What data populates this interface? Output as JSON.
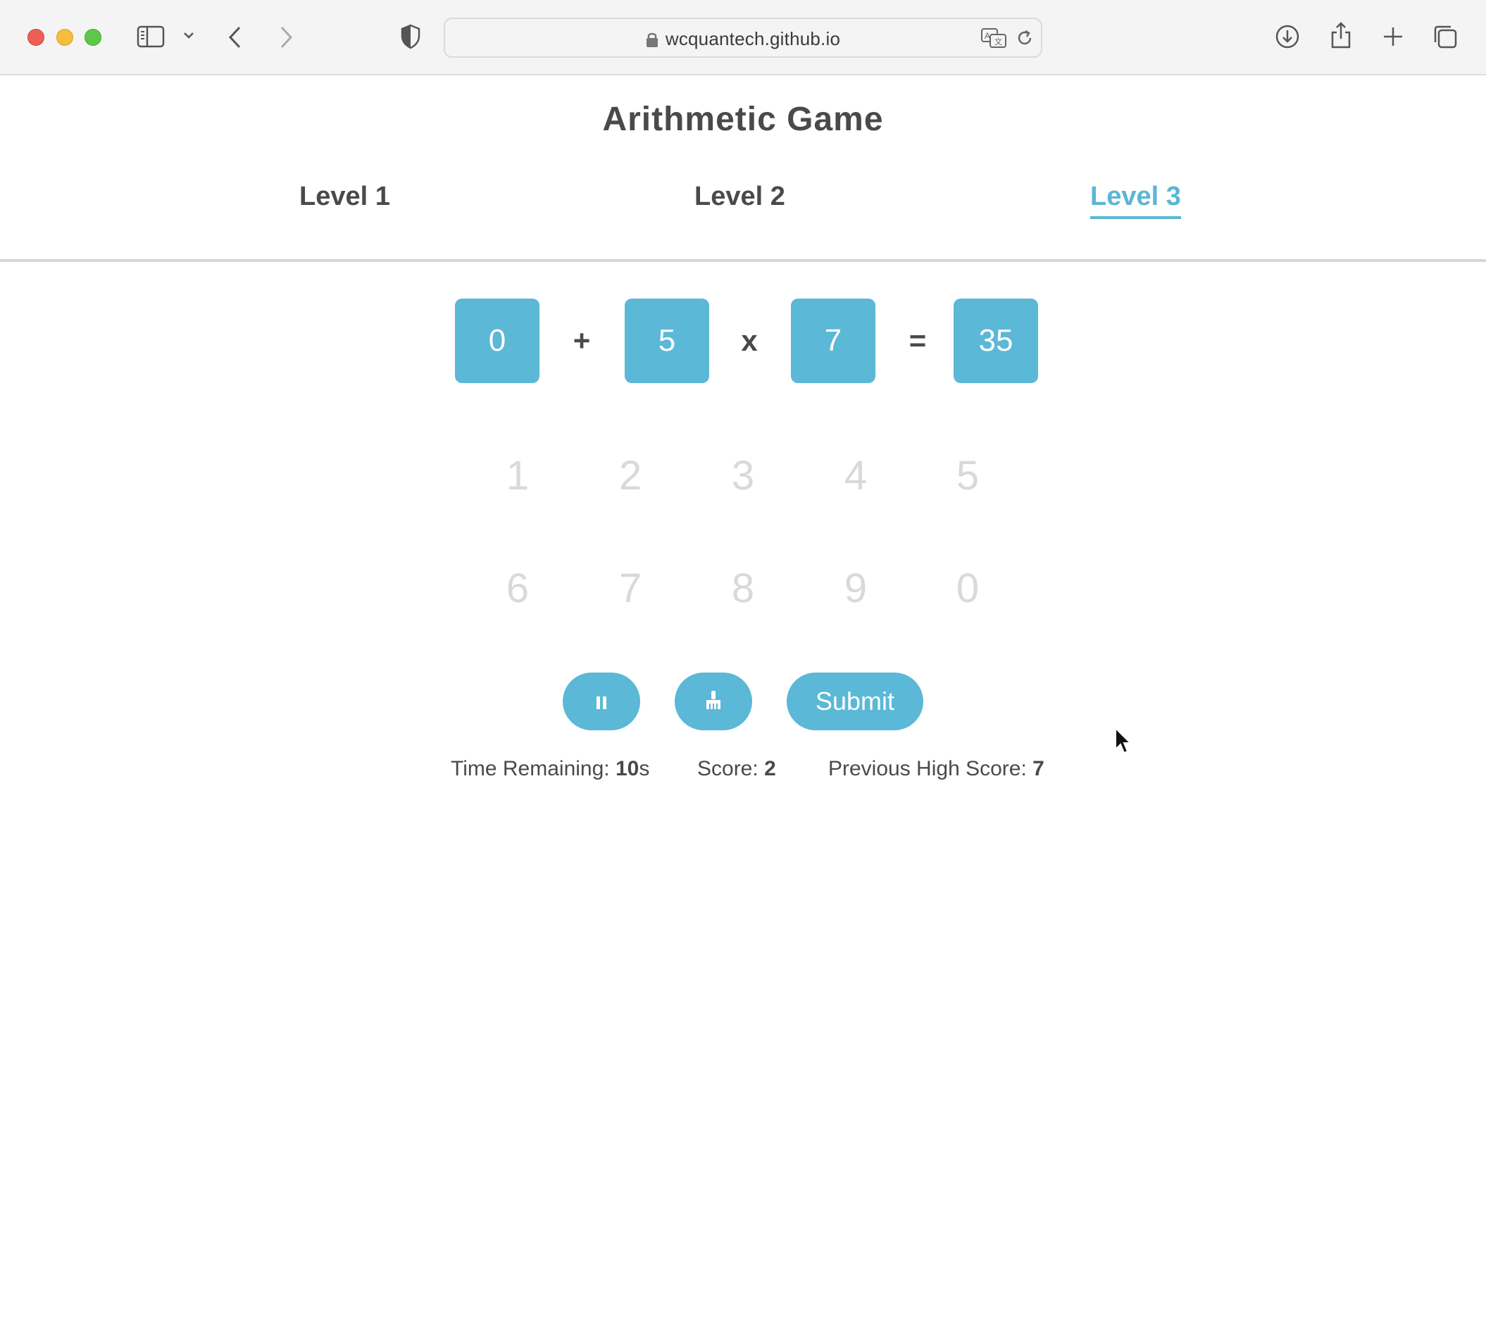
{
  "browser": {
    "url": "wcquantech.github.io"
  },
  "page": {
    "title": "Arithmetic Game",
    "tabs": [
      {
        "label": "Level 1",
        "active": false
      },
      {
        "label": "Level 2",
        "active": false
      },
      {
        "label": "Level 3",
        "active": true
      }
    ]
  },
  "equation": {
    "operand_a": "0",
    "op1": "+",
    "operand_b": "5",
    "op2": "x",
    "operand_c": "7",
    "equals": "=",
    "result": "35"
  },
  "keypad": {
    "row1": [
      "1",
      "2",
      "3",
      "4",
      "5"
    ],
    "row2": [
      "6",
      "7",
      "8",
      "9",
      "0"
    ]
  },
  "controls": {
    "pause_icon": "pause-icon",
    "clear_icon": "broom-icon",
    "submit_label": "Submit"
  },
  "stats": {
    "time_label": "Time Remaining:",
    "time_value": "10",
    "time_unit": "s",
    "score_label": "Score:",
    "score_value": "2",
    "high_label": "Previous High Score:",
    "high_value": "7"
  },
  "colors": {
    "accent": "#5bb8d6",
    "text": "#4a4a4a",
    "keypad_disabled": "#d9d9d9"
  }
}
